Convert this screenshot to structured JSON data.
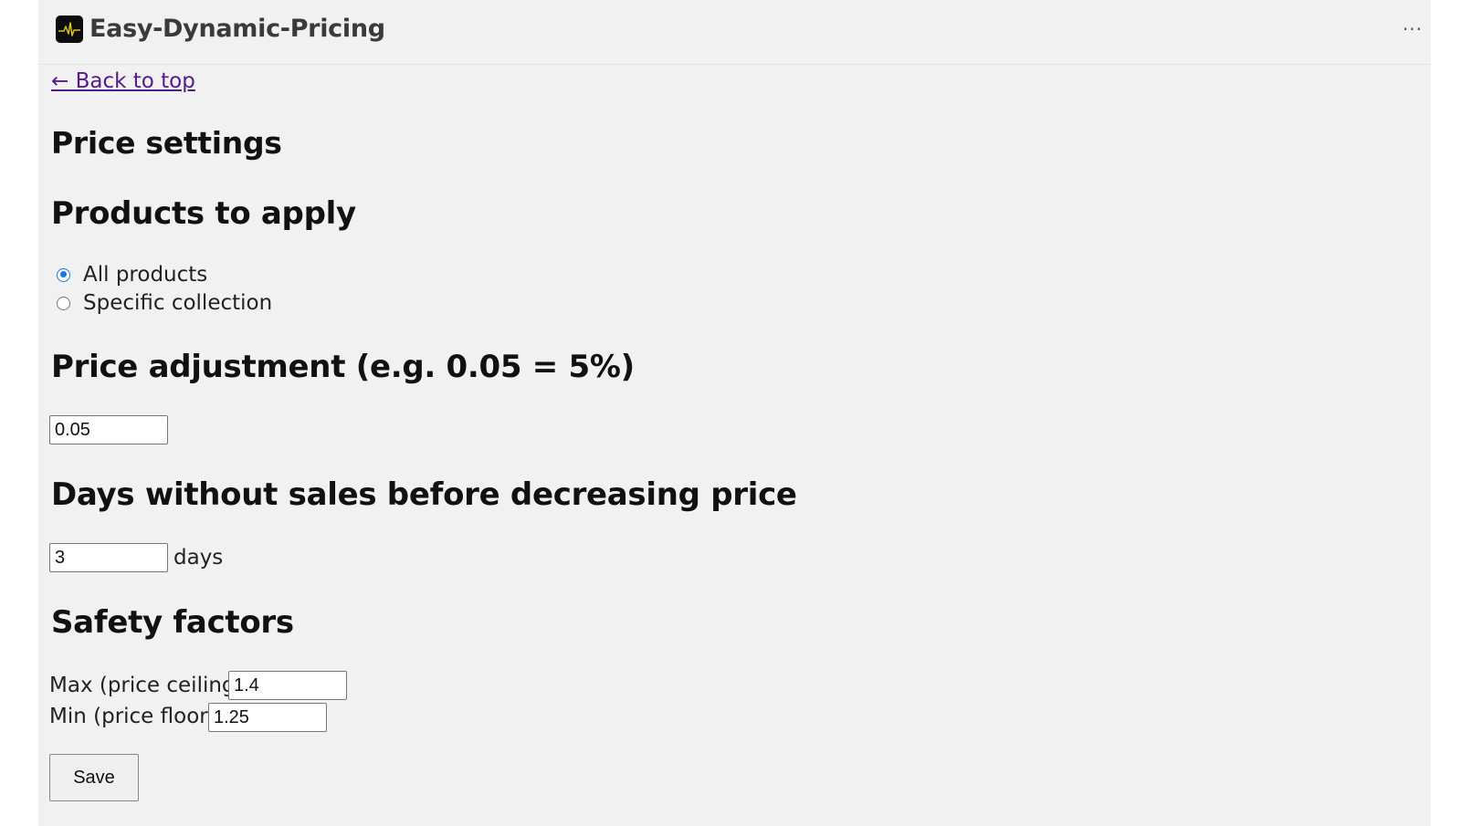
{
  "app": {
    "title": "Easy-Dynamic-Pricing",
    "logo_icon": "pricing-chart-logo-icon",
    "more_menu_label": "···"
  },
  "nav": {
    "back_link": "← Back to top"
  },
  "page": {
    "title": "Price settings"
  },
  "products": {
    "heading": "Products to apply",
    "options": [
      {
        "label": "All products",
        "checked": true
      },
      {
        "label": "Specific collection",
        "checked": false
      }
    ]
  },
  "price_adjustment": {
    "heading": "Price adjustment (e.g. 0.05 = 5%)",
    "value": "0.05"
  },
  "days_without_sales": {
    "heading": "Days without sales before decreasing price",
    "value": "3",
    "unit": "days"
  },
  "safety_factors": {
    "heading": "Safety factors",
    "max_label": "Max (price ceiling)",
    "max_value": "1.4",
    "min_label": "Min (price floor)",
    "min_value": "1.25"
  },
  "actions": {
    "save_label": "Save"
  },
  "colors": {
    "background": "#f1f1f1",
    "link": "#551a8b",
    "radio_accent": "#1a73e8"
  }
}
